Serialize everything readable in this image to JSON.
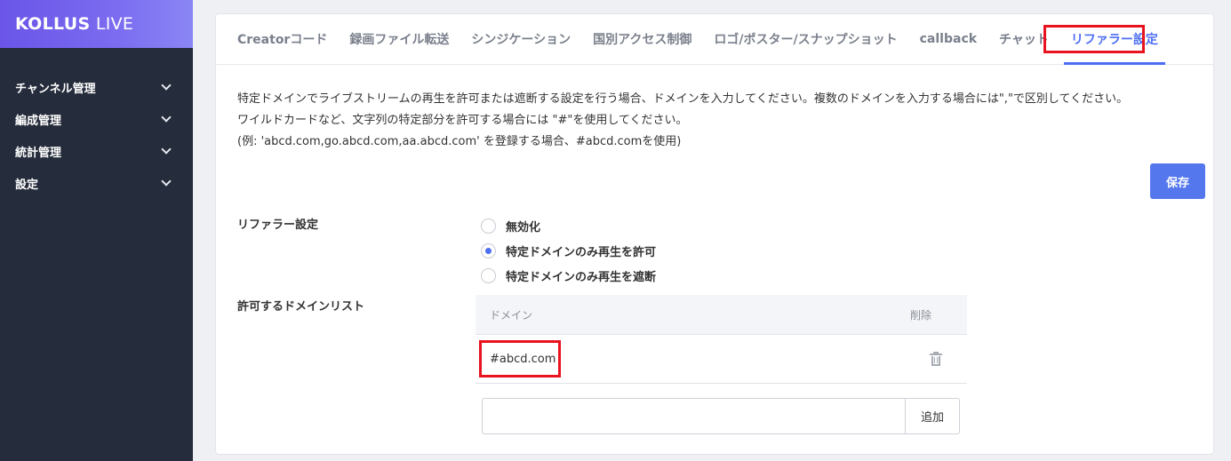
{
  "sidebar": {
    "logo_bold": "KOLLUS",
    "logo_light": "LIVE",
    "items": [
      {
        "label": "チャンネル管理"
      },
      {
        "label": "編成管理"
      },
      {
        "label": "統計管理"
      },
      {
        "label": "設定"
      }
    ]
  },
  "tabs": [
    {
      "label": "Creatorコード"
    },
    {
      "label": "録画ファイル転送"
    },
    {
      "label": "シンジケーション"
    },
    {
      "label": "国別アクセス制御"
    },
    {
      "label": "ロゴ/ポスター/スナップショット"
    },
    {
      "label": "callback"
    },
    {
      "label": "チャット"
    },
    {
      "label": "リファラー設定",
      "active": true
    }
  ],
  "description": {
    "line1": "特定ドメインでライブストリームの再生を許可または遮断する設定を行う場合、ドメインを入力してください。複数のドメインを入力する場合には\",\"で区別してください。",
    "line2": "ワイルドカードなど、文字列の特定部分を許可する場合には \"#\"を使用してください。",
    "line3": "(例: 'abcd.com,go.abcd.com,aa.abcd.com' を登録する場合、#abcd.comを使用)"
  },
  "save_label": "保存",
  "referrer": {
    "label": "リファラー設定",
    "options": [
      {
        "label": "無効化",
        "checked": false
      },
      {
        "label": "特定ドメインのみ再生を許可",
        "checked": true
      },
      {
        "label": "特定ドメインのみ再生を遮断",
        "checked": false
      }
    ]
  },
  "domain_list": {
    "label": "許可するドメインリスト",
    "col_domain": "ドメイン",
    "col_delete": "削除",
    "rows": [
      {
        "domain": "#abcd.com"
      }
    ],
    "input_value": "",
    "add_label": "追加"
  },
  "colors": {
    "accent": "#4d6ef3",
    "highlight": "#e8131f",
    "sidebar_bg": "#252c3b"
  }
}
